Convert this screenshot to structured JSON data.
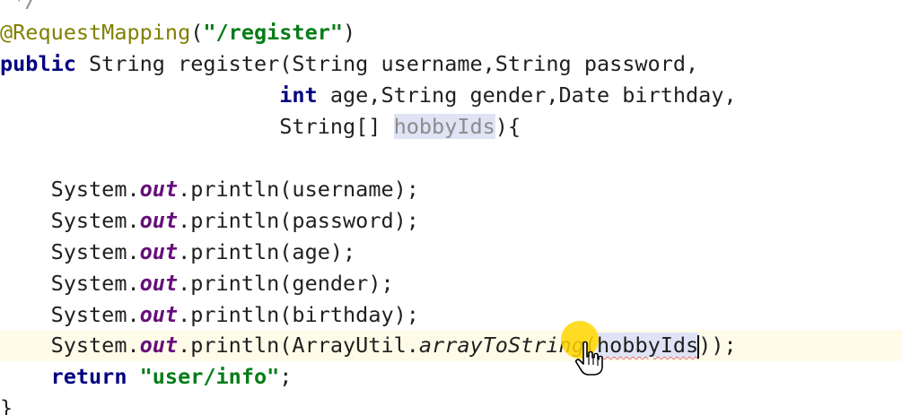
{
  "editor": {
    "colors": {
      "annotation": "#808000",
      "string": "#067d17",
      "keyword": "#000080",
      "field": "#660e7a",
      "current_line": "#fffbe9",
      "reference_highlight": "#dfe3f5",
      "cursor_highlight": "#ffd600"
    },
    "lines": {
      "l0": {
        "text": " */"
      },
      "l1": {
        "annotation": "@RequestMapping",
        "open": "(",
        "string": "\"/register\"",
        "close": ")"
      },
      "l2": {
        "kw": "public",
        "rest": " String register(String username,String password,"
      },
      "l3": {
        "indent": "                      ",
        "kw": "int",
        "rest": " age,String gender,Date birthday,"
      },
      "l4": {
        "indent": "                      ",
        "pre": "String[] ",
        "param": "hobbyIds",
        "post": "){"
      },
      "l5": {
        "prefix": "    System.",
        "field": "out",
        "call": ".println(username);"
      },
      "l6": {
        "prefix": "    System.",
        "field": "out",
        "call": ".println(password);"
      },
      "l7": {
        "prefix": "    System.",
        "field": "out",
        "call": ".println(age);"
      },
      "l8": {
        "prefix": "    System.",
        "field": "out",
        "call": ".println(gender);"
      },
      "l9": {
        "prefix": "    System.",
        "field": "out",
        "call": ".println(birthday);"
      },
      "l10": {
        "prefix": "    System.",
        "field": "out",
        "call": ".println(ArrayUtil.",
        "method": "arrayToString",
        "open": "(",
        "arg": "hobbyIds",
        "close": "));"
      },
      "l11": {
        "indent": "    ",
        "kw": "return",
        "space": " ",
        "string": "\"user/info\"",
        "end": ";"
      },
      "l12": {
        "text": "}"
      }
    }
  },
  "cursor": {
    "icon": "hand-pointer-icon"
  }
}
